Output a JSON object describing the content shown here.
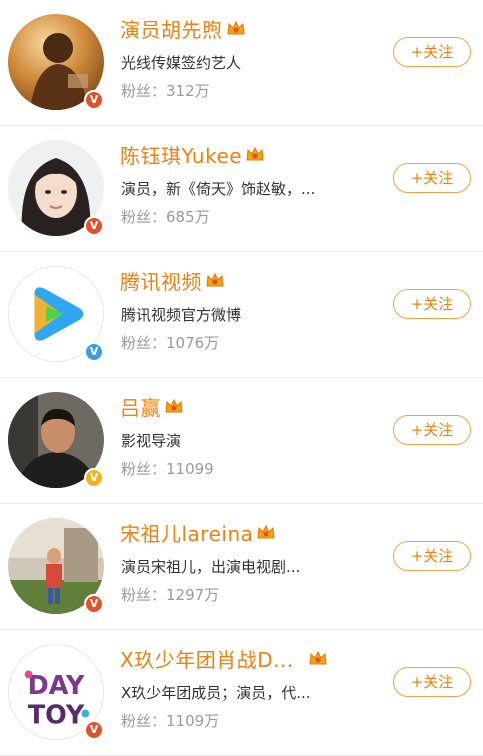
{
  "colors": {
    "name": "#f0800f",
    "follow_border": "#f0a24a",
    "verified_red": "#e4502a",
    "verified_blue": "#3a9ee4",
    "verified_yellow": "#f2b21a"
  },
  "follow_label": "+关注",
  "users": [
    {
      "name": "演员胡先煦",
      "description": "光线传媒签约艺人",
      "fans": "粉丝：312万",
      "verified": "red",
      "avatar": "avatar-photo-warm"
    },
    {
      "name": "陈钰琪Yukee",
      "description": "演员，新《倚天》饰赵敏，...",
      "fans": "粉丝：685万",
      "verified": "red",
      "avatar": "avatar-photo-portrait"
    },
    {
      "name": "腾讯视频",
      "description": "腾讯视频官方微博",
      "fans": "粉丝：1076万",
      "verified": "blue",
      "avatar": "tencent-video-logo"
    },
    {
      "name": "吕赢",
      "description": "影视导演",
      "fans": "粉丝：11099",
      "verified": "yellow",
      "avatar": "avatar-photo-man"
    },
    {
      "name": "宋祖儿lareina",
      "description": "演员宋祖儿，出演电视剧...",
      "fans": "粉丝：1297万",
      "verified": "red",
      "avatar": "avatar-photo-child"
    },
    {
      "name": "X玖少年团肖战D...",
      "description": "X玖少年团成员；演员，代...",
      "fans": "粉丝：1109万",
      "verified": "red",
      "avatar": "daytoy-logo"
    }
  ]
}
